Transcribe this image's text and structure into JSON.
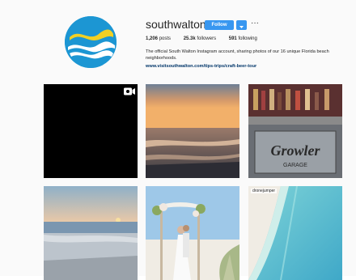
{
  "profile": {
    "username": "southwalton",
    "follow_label": "Follow",
    "more_label": "···",
    "stats": {
      "posts_count": "1,206",
      "posts_label": "posts",
      "followers_count": "25.3k",
      "followers_label": "followers",
      "following_count": "591",
      "following_label": "following"
    },
    "bio": "The official South Walton Instagram account, sharing photos of our 16 unique Florida beach neighborhoods.",
    "link": "www.visitsouthwalton.com/tips-trips/craft-beer-tour"
  },
  "posts": [
    {
      "kind": "video",
      "icon": "video-camera-icon"
    },
    {
      "kind": "image",
      "subject": "sunset beach"
    },
    {
      "kind": "image",
      "subject": "growler garage bar"
    },
    {
      "kind": "image",
      "subject": "beach sunset shore",
      "tag": ""
    },
    {
      "kind": "image",
      "subject": "beach wedding"
    },
    {
      "kind": "image",
      "subject": "aerial shoreline",
      "tag": "dronejumper"
    }
  ],
  "colors": {
    "accent": "#3897f0",
    "logo_blue": "#1c96d3",
    "logo_yellow": "#f2d024"
  }
}
